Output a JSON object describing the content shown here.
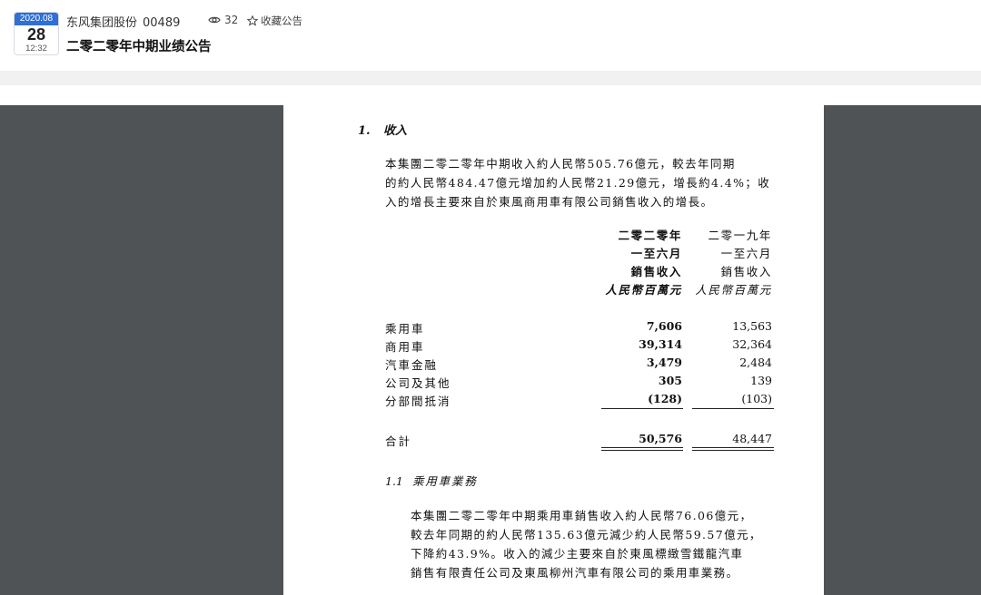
{
  "header": {
    "date_ym": "2020.08",
    "date_day": "28",
    "date_time": "12:32",
    "company": "东风集团股份",
    "stock_code": "00489",
    "views": "32",
    "favorite_label": "收藏公告",
    "title": "二零二零年中期业绩公告"
  },
  "document": {
    "section_number": "1.",
    "section_title": "收入",
    "paragraph1_lines": [
      "本集團二零二零年中期收入約人民幣505.76億元，較去年同期",
      "的約人民幣484.47億元增加約人民幣21.29億元，增長約4.4%；收",
      "入的增長主要來自於東風商用車有限公司銷售收入的增長。"
    ],
    "table": {
      "current_header": [
        "二零二零年",
        "一至六月",
        "銷售收入",
        "人民幣百萬元"
      ],
      "previous_header": [
        "二零一九年",
        "一至六月",
        "銷售收入",
        "人民幣百萬元"
      ],
      "rows": [
        {
          "label": "乘用車",
          "current": "7,606",
          "previous": "13,563"
        },
        {
          "label": "商用車",
          "current": "39,314",
          "previous": "32,364"
        },
        {
          "label": "汽車金融",
          "current": "3,479",
          "previous": "2,484"
        },
        {
          "label": "公司及其他",
          "current": "305",
          "previous": "139"
        },
        {
          "label": "分部間抵消",
          "current": "(128)",
          "previous": "(103)"
        }
      ],
      "total": {
        "label": "合計",
        "current": "50,576",
        "previous": "48,447"
      }
    },
    "subsection_number": "1.1",
    "subsection_title": "乘用車業務",
    "paragraph2_lines": [
      "本集團二零二零年中期乘用車銷售收入約人民幣76.06億元，",
      "較去年同期的約人民幣135.63億元減少約人民幣59.57億元，",
      "下降約43.9%。收入的減少主要來自於東風標緻雪鐵龍汽車",
      "銷售有限責任公司及東風柳州汽車有限公司的乘用車業務。"
    ]
  },
  "colors": {
    "accent": "#2f6fd6",
    "viewer_background": "#4f5355",
    "header_strip": "#f1f1f1"
  }
}
